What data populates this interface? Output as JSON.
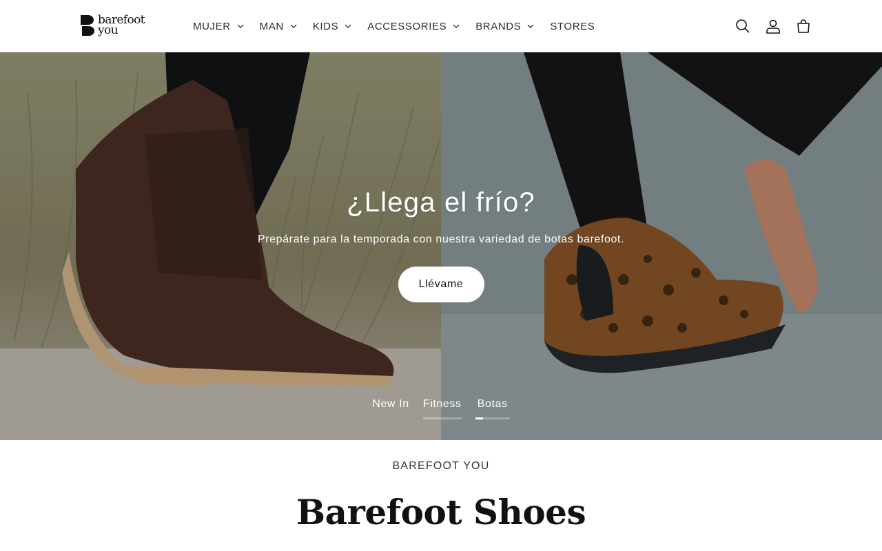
{
  "header": {
    "logo": {
      "line1": "barefoot",
      "line2": "you"
    },
    "nav": [
      {
        "label": "MUJER",
        "dropdown": true
      },
      {
        "label": "MAN",
        "dropdown": true
      },
      {
        "label": "KIDS",
        "dropdown": true
      },
      {
        "label": "ACCESSORIES",
        "dropdown": true
      },
      {
        "label": "BRANDS",
        "dropdown": true
      },
      {
        "label": "STORES",
        "dropdown": false
      }
    ],
    "icons": [
      "search-icon",
      "account-icon",
      "cart-icon"
    ]
  },
  "hero": {
    "title": "¿Llega el frío?",
    "subtitle": "Prepárate para la temporada con nuestra variedad de botas barefoot.",
    "button": "Llévame",
    "tabs": [
      {
        "label": "New In",
        "active": false
      },
      {
        "label": "Fitness",
        "active": false
      },
      {
        "label": "Botas",
        "active": true
      }
    ]
  },
  "intro": {
    "eyebrow": "BAREFOOT YOU",
    "headline": "Barefoot Shoes"
  },
  "colors": {
    "accent": "#121212",
    "background": "#ffffff"
  }
}
